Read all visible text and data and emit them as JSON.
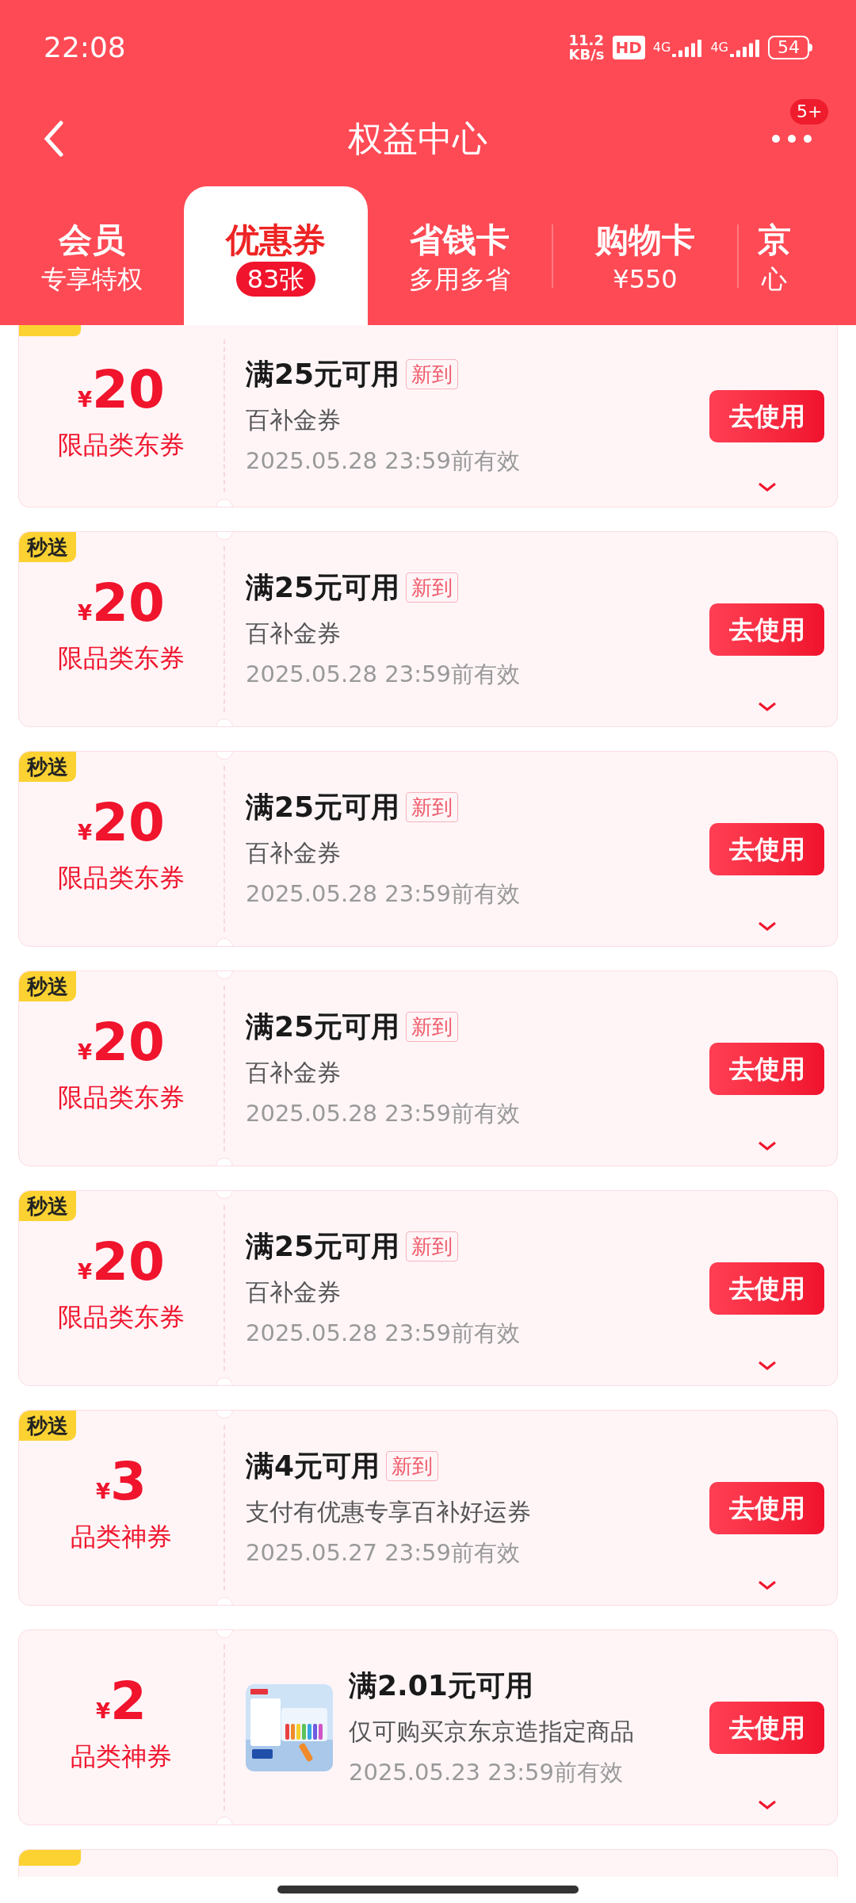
{
  "status_bar": {
    "time": "22:08",
    "speed_value": "11.2",
    "speed_unit": "KB/s",
    "hd": "HD",
    "networks": [
      "4G",
      "4G"
    ],
    "battery": "54"
  },
  "header": {
    "title": "权益中心",
    "more_badge": "5+"
  },
  "tabs": [
    {
      "title": "会员",
      "subtitle": "专享特权",
      "selected": false
    },
    {
      "title": "优惠券",
      "subtitle": "83张",
      "selected": true
    },
    {
      "title": "省钱卡",
      "subtitle": "多用多省",
      "selected": false
    },
    {
      "title": "购物卡",
      "subtitle": "¥550",
      "selected": false
    },
    {
      "title": "京",
      "subtitle": "心",
      "selected": false
    }
  ],
  "coupons": [
    {
      "kind": "cut_top",
      "currency": "¥",
      "amount": "20",
      "category": "限品类东券",
      "condition": "满25元可用",
      "tag": "新到",
      "description": "百补金券",
      "validity": "2025.05.28 23:59前有效",
      "button": "去使用"
    },
    {
      "kind": "full",
      "badge": "秒送",
      "currency": "¥",
      "amount": "20",
      "category": "限品类东券",
      "condition": "满25元可用",
      "tag": "新到",
      "description": "百补金券",
      "validity": "2025.05.28 23:59前有效",
      "button": "去使用"
    },
    {
      "kind": "full",
      "badge": "秒送",
      "currency": "¥",
      "amount": "20",
      "category": "限品类东券",
      "condition": "满25元可用",
      "tag": "新到",
      "description": "百补金券",
      "validity": "2025.05.28 23:59前有效",
      "button": "去使用"
    },
    {
      "kind": "full",
      "badge": "秒送",
      "currency": "¥",
      "amount": "20",
      "category": "限品类东券",
      "condition": "满25元可用",
      "tag": "新到",
      "description": "百补金券",
      "validity": "2025.05.28 23:59前有效",
      "button": "去使用"
    },
    {
      "kind": "full",
      "badge": "秒送",
      "currency": "¥",
      "amount": "20",
      "category": "限品类东券",
      "condition": "满25元可用",
      "tag": "新到",
      "description": "百补金券",
      "validity": "2025.05.28 23:59前有效",
      "button": "去使用"
    },
    {
      "kind": "full",
      "badge": "秒送",
      "currency": "¥",
      "amount": "3",
      "category": "品类神券",
      "condition": "满4元可用",
      "tag": "新到",
      "description": "支付有优惠专享百补好运券",
      "validity": "2025.05.27 23:59前有效",
      "button": "去使用"
    },
    {
      "kind": "full",
      "currency": "¥",
      "amount": "2",
      "category": "品类神券",
      "condition": "满2.01元可用",
      "description": "仅可购买京东京造指定商品",
      "validity": "2025.05.23 23:59前有效",
      "button": "去使用"
    },
    {
      "kind": "partial"
    }
  ]
}
